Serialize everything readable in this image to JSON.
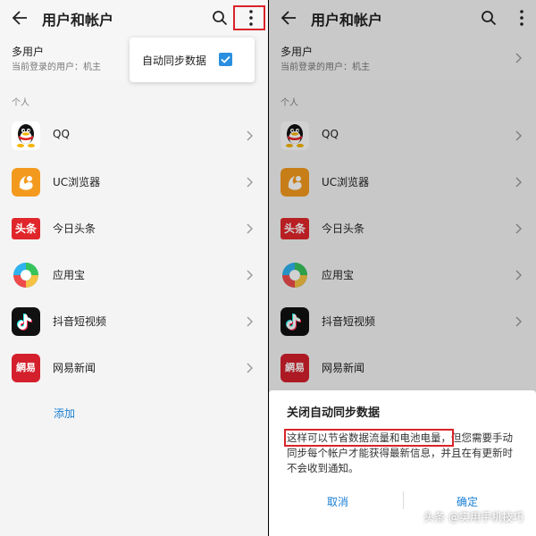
{
  "left": {
    "title": "用户和帐户",
    "multi_user": {
      "title": "多用户",
      "subtitle": "当前登录的用户：机主"
    },
    "section_label": "个人",
    "apps": [
      {
        "label": "QQ",
        "icon": "qq-icon"
      },
      {
        "label": "UC浏览器",
        "icon": "uc-browser-icon"
      },
      {
        "label": "今日头条",
        "icon": "toutiao-icon"
      },
      {
        "label": "应用宝",
        "icon": "yingyongbao-icon"
      },
      {
        "label": "抖音短视频",
        "icon": "douyin-icon"
      },
      {
        "label": "网易新闻",
        "icon": "netease-news-icon"
      }
    ],
    "add_label": "添加",
    "menu": {
      "item_label": "自动同步数据",
      "checked": true
    }
  },
  "right": {
    "title": "用户和帐户",
    "multi_user": {
      "title": "多用户",
      "subtitle": "当前登录的用户：机主"
    },
    "section_label": "个人",
    "apps": [
      {
        "label": "QQ",
        "icon": "qq-icon"
      },
      {
        "label": "UC浏览器",
        "icon": "uc-browser-icon"
      },
      {
        "label": "今日头条",
        "icon": "toutiao-icon"
      },
      {
        "label": "应用宝",
        "icon": "yingyongbao-icon"
      },
      {
        "label": "抖音短视频",
        "icon": "douyin-icon"
      },
      {
        "label": "网易新闻",
        "icon": "netease-news-icon"
      }
    ],
    "dialog": {
      "title": "关闭自动同步数据",
      "body_highlight": "这样可以节省数据流量和电池电量，",
      "body_rest": "但您需要手动同步每个帐户才能获得最新信息，并且在有更新时不会收到通知。",
      "cancel_label": "取消",
      "ok_label": "确定"
    }
  },
  "icon_logo_text": {
    "toutiao": "头条",
    "netease": "網易"
  },
  "watermark": "头条 @实用手机技巧",
  "colors": {
    "accent": "#1a7fd4",
    "highlight": "#d9232a",
    "checkbox": "#2a8fe0"
  }
}
